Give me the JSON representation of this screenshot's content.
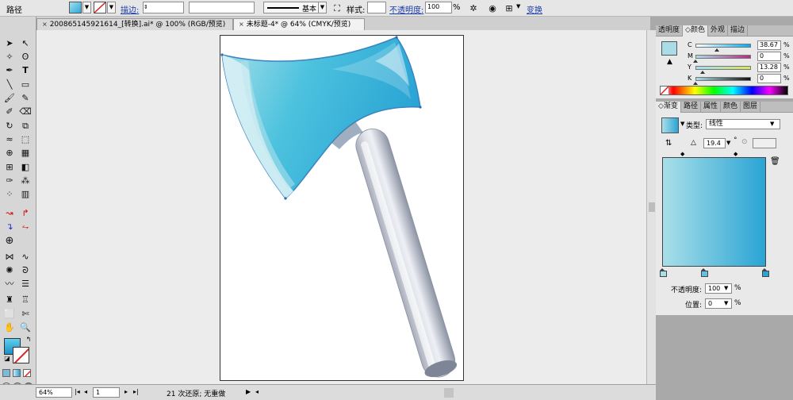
{
  "control_bar": {
    "selection": "路径",
    "stroke_label": "描边:",
    "stroke_style": "基本",
    "style_label": "样式:",
    "opacity_label": "不透明度:",
    "opacity_value": "100",
    "opacity_unit": "%",
    "transform_label": "变换",
    "fill_color": "#3bb6d6"
  },
  "tabs": [
    {
      "label": "200865145921614_[转换].ai* @ 100% (RGB/预览)",
      "close": "×"
    },
    {
      "label": "未标题-4* @ 64% (CMYK/预览)",
      "close": "×"
    }
  ],
  "tools": {
    "fill_color": "#2fa9d5",
    "stroke_color": "#ffffff"
  },
  "color_panel": {
    "tabs": [
      "透明度",
      "颜色",
      "外观",
      "描边"
    ],
    "active_tab": "颜色",
    "swatch": "#a9dce6",
    "channels": [
      {
        "name": "C",
        "value": "38.67",
        "unit": "%",
        "level": 0.3867,
        "grad": "linear-gradient(to right,#fff,#00aeef)"
      },
      {
        "name": "M",
        "value": "0",
        "unit": "%",
        "level": 0,
        "grad": "linear-gradient(to right,#a9dce6,#b62c84)"
      },
      {
        "name": "Y",
        "value": "13.28",
        "unit": "%",
        "level": 0.1328,
        "grad": "linear-gradient(to right,#9fe0f4,#d8e65c)"
      },
      {
        "name": "K",
        "value": "0",
        "unit": "%",
        "level": 0,
        "grad": "linear-gradient(to right,#a9dce6,#111)"
      }
    ]
  },
  "gradient_panel": {
    "tabs": [
      "渐变",
      "路径",
      "属性",
      "颜色",
      "图层"
    ],
    "active_tab": "渐变",
    "type_label": "类型:",
    "type_value": "线性",
    "angle_value": "19.4",
    "angle_unit": "°",
    "start_color": "#a9dfe9",
    "end_color": "#2aa4d4",
    "opacity_label": "不透明度:",
    "opacity_value": "100",
    "opacity_unit": "%",
    "location_label": "位置:",
    "location_value": "0",
    "location_unit": "%"
  },
  "status_bar": {
    "zoom": "64%",
    "page": "1",
    "info": "21 次还原; 无重做"
  }
}
